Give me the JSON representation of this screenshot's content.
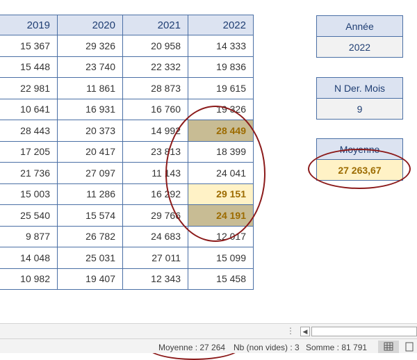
{
  "table": {
    "headers": [
      "2019",
      "2020",
      "2021",
      "2022"
    ],
    "rows": [
      [
        "15 367",
        "29 326",
        "20 958",
        "14 333"
      ],
      [
        "15 448",
        "23 740",
        "22 332",
        "19 836"
      ],
      [
        "22 981",
        "11 861",
        "28 873",
        "19 615"
      ],
      [
        "10 641",
        "16 931",
        "16 760",
        "19 326"
      ],
      [
        "28 443",
        "20 373",
        "14 992",
        "28 449"
      ],
      [
        "17 205",
        "20 417",
        "23 813",
        "18 399"
      ],
      [
        "21 736",
        "27 097",
        "11 143",
        "24 041"
      ],
      [
        "15 003",
        "11 286",
        "16 292",
        "29 151"
      ],
      [
        "25 540",
        "15 574",
        "29 766",
        "24 191"
      ],
      [
        "9 877",
        "26 782",
        "24 683",
        "12 017"
      ],
      [
        "14 048",
        "25 031",
        "27 011",
        "15 099"
      ],
      [
        "10 982",
        "19 407",
        "12 343",
        "15 458"
      ]
    ]
  },
  "side": {
    "year_label": "Année",
    "year_value": "2022",
    "months_label": "N Der. Mois",
    "months_value": "9",
    "avg_label": "Moyenne",
    "avg_value": "27 263,67"
  },
  "status": {
    "average": "Moyenne : 27 264",
    "count": "Nb (non vides) : 3",
    "sum": "Somme : 81 791"
  },
  "colors": {
    "annotation": "#8b1a1a",
    "highlight_dark": "#c8bc94",
    "highlight_light": "#fff2c6",
    "header_fill": "#dce3f1"
  },
  "icons": {
    "scroll_left": "◀",
    "scroll_dots": "⋮"
  }
}
